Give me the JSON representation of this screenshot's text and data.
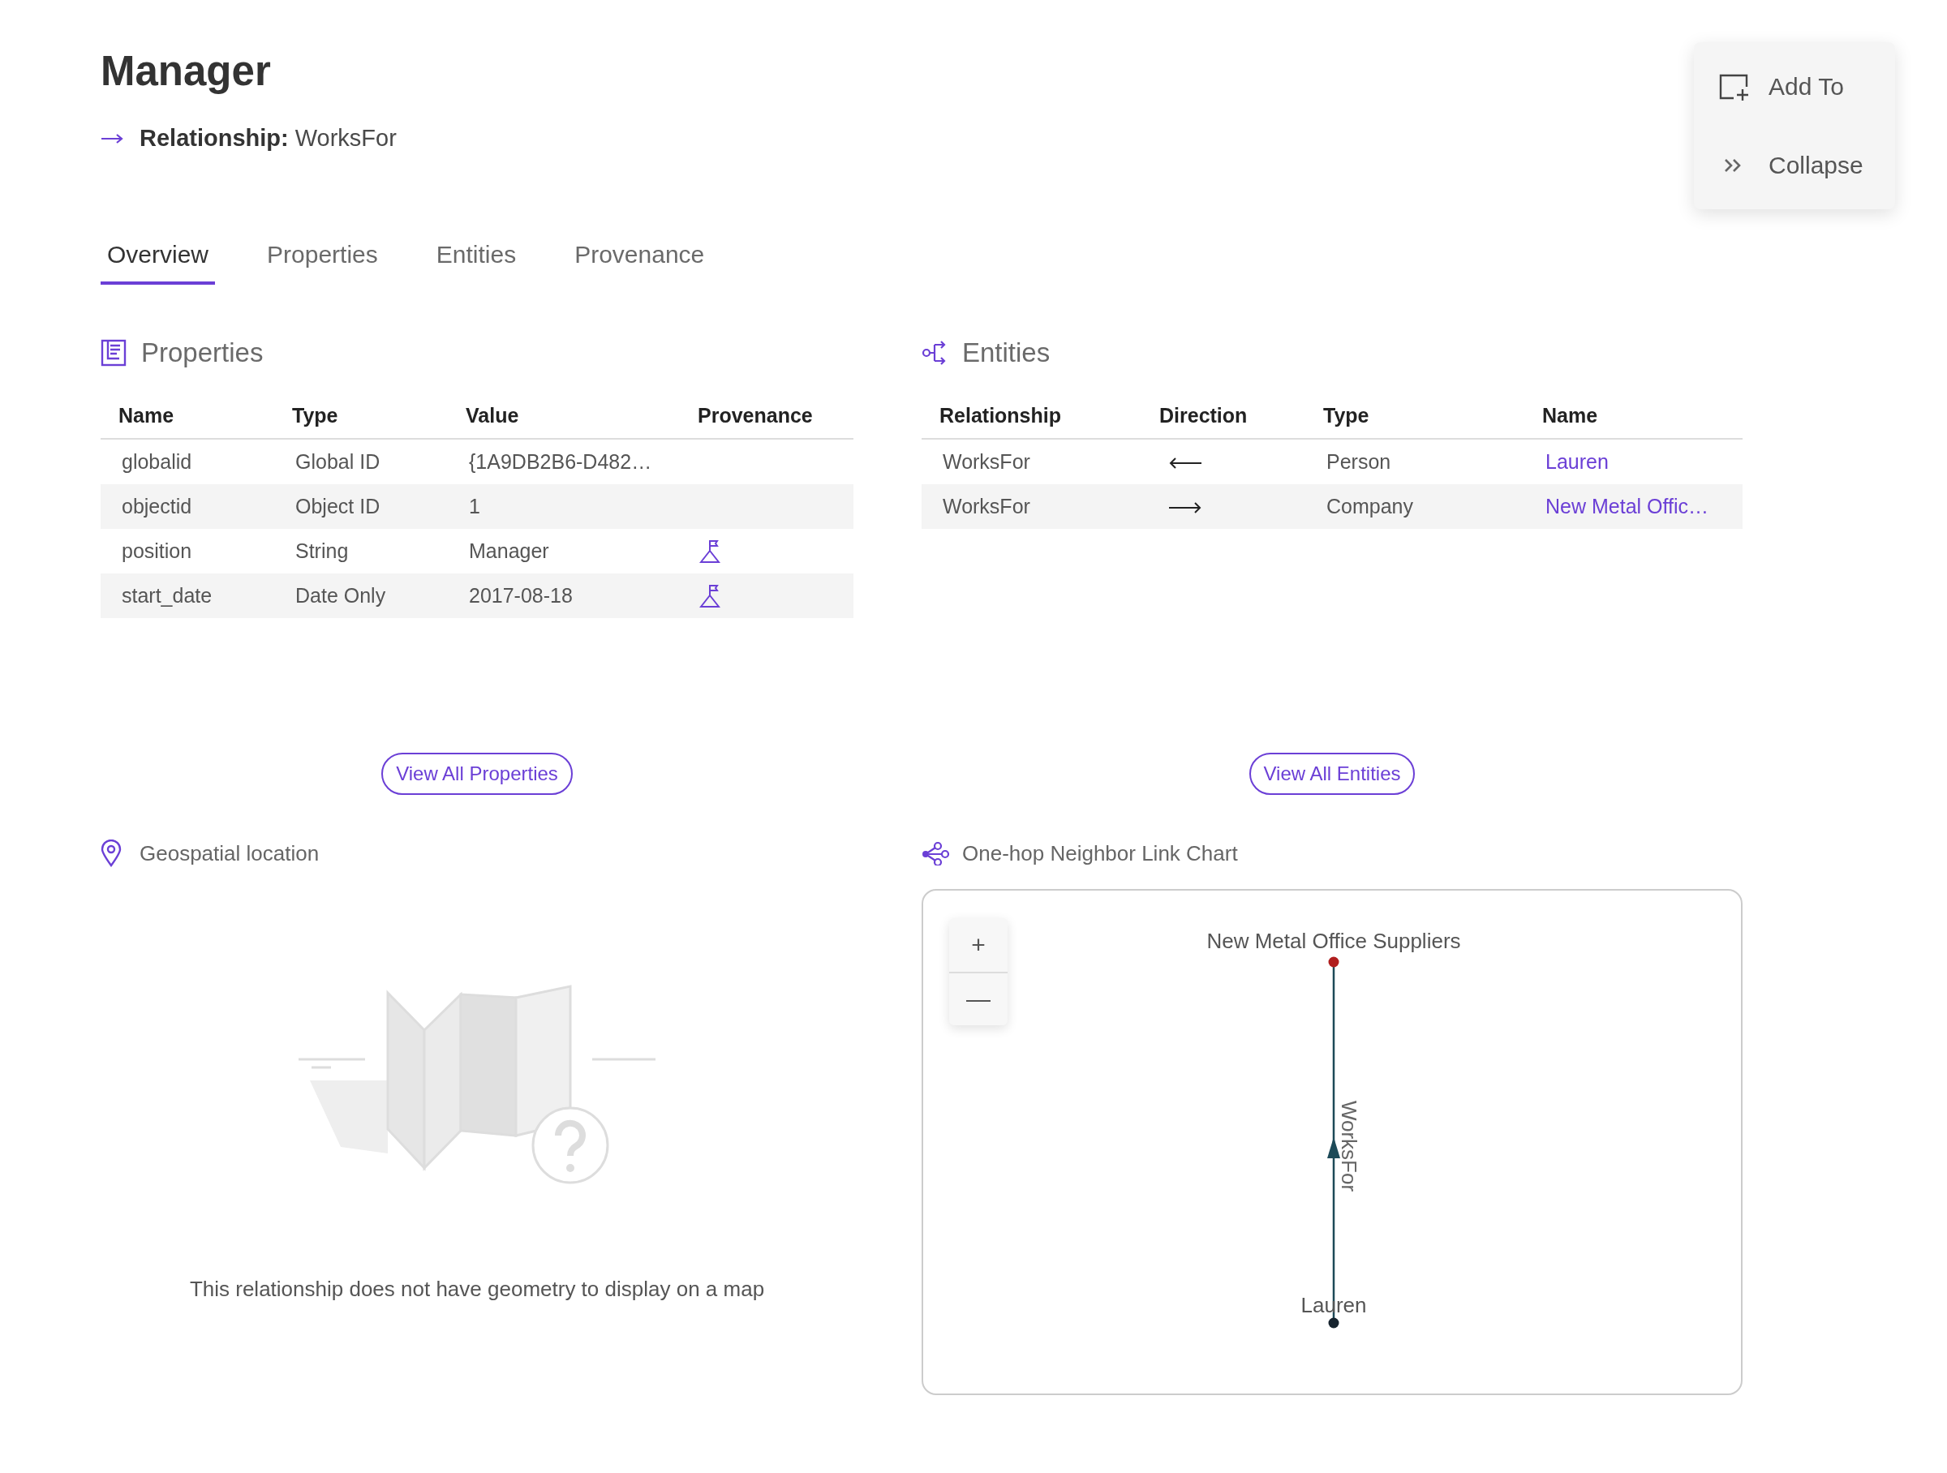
{
  "header": {
    "title": "Manager",
    "relationship_label": "Relationship:",
    "relationship_value": "WorksFor"
  },
  "actions": [
    {
      "kind": "add",
      "label": "Add To"
    },
    {
      "kind": "collapse",
      "label": "Collapse"
    }
  ],
  "tabs": [
    {
      "label": "Overview",
      "selected": true
    },
    {
      "label": "Properties",
      "selected": false
    },
    {
      "label": "Entities",
      "selected": false
    },
    {
      "label": "Provenance",
      "selected": false
    }
  ],
  "properties_panel": {
    "title": "Properties",
    "columns": [
      "Name",
      "Type",
      "Value",
      "Provenance"
    ],
    "rows": [
      {
        "name": "globalid",
        "type": "Global ID",
        "value": "{1A9DB2B6-D482…",
        "provenance": false
      },
      {
        "name": "objectid",
        "type": "Object ID",
        "value": "1",
        "provenance": false
      },
      {
        "name": "position",
        "type": "String",
        "value": "Manager",
        "provenance": true
      },
      {
        "name": "start_date",
        "type": "Date Only",
        "value": "2017-08-18",
        "provenance": true
      }
    ],
    "button": "View All Properties"
  },
  "entities_panel": {
    "title": "Entities",
    "columns": [
      "Relationship",
      "Direction",
      "Type",
      "Name"
    ],
    "rows": [
      {
        "relationship": "WorksFor",
        "kind": "incoming",
        "type": "Person",
        "name": "Lauren"
      },
      {
        "relationship": "WorksFor",
        "kind": "outgoing",
        "type": "Company",
        "name": "New Metal Offic…"
      }
    ],
    "button": "View All Entities"
  },
  "geospatial": {
    "title": "Geospatial location",
    "message": "This relationship does not have geometry to display on a map"
  },
  "link_chart": {
    "title": "One-hop Neighbor Link Chart",
    "zoom_in": "+",
    "zoom_out": "—",
    "nodes": [
      {
        "label": "New Metal Office Suppliers",
        "color": "#b01e1e"
      },
      {
        "label": "Lauren",
        "color": "#16232e"
      }
    ],
    "edge_label": "WorksFor"
  }
}
